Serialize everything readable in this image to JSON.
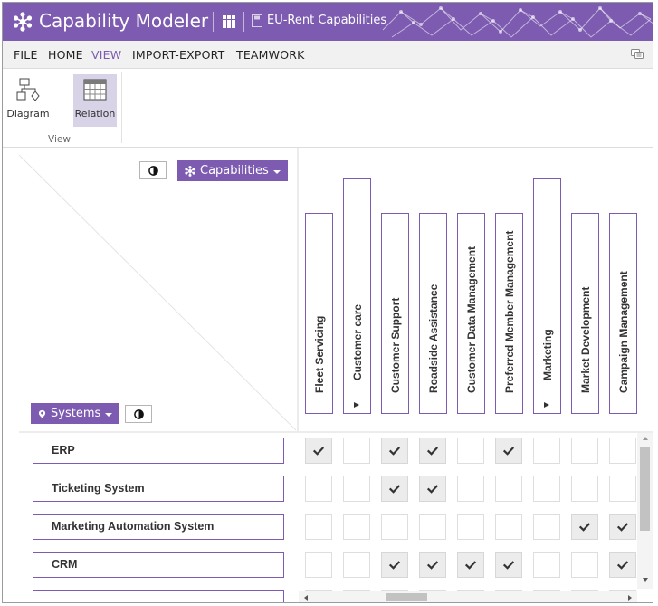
{
  "app": {
    "title": "Capability Modeler",
    "document": "EU-Rent Capabilities",
    "accent_color": "#7c5bb0"
  },
  "menu": {
    "items": [
      {
        "label": "FILE",
        "active": false
      },
      {
        "label": "HOME",
        "active": false
      },
      {
        "label": "VIEW",
        "active": true
      },
      {
        "label": "IMPORT-EXPORT",
        "active": false
      },
      {
        "label": "TEAMWORK",
        "active": false
      }
    ],
    "chat_icon": "chat-icon"
  },
  "ribbon": {
    "buttons": [
      {
        "label": "Diagram",
        "icon": "diagram-icon",
        "active": false
      },
      {
        "label": "Relation",
        "icon": "relation-grid-icon",
        "active": true
      }
    ],
    "group_label": "View"
  },
  "matrix": {
    "capabilities_button": "Capabilities",
    "systems_button": "Systems",
    "columns": [
      {
        "label": "Fleet Servicing",
        "expandable": false
      },
      {
        "label": "Customer care",
        "expandable": true
      },
      {
        "label": "Customer Support",
        "expandable": false
      },
      {
        "label": "Roadside Assistance",
        "expandable": false
      },
      {
        "label": "Customer Data Management",
        "expandable": false
      },
      {
        "label": "Preferred Member Management",
        "expandable": false
      },
      {
        "label": "Marketing",
        "expandable": true
      },
      {
        "label": "Market Development",
        "expandable": false
      },
      {
        "label": "Campaign Management",
        "expandable": false
      }
    ],
    "rows": [
      {
        "label": "ERP",
        "checks": [
          true,
          false,
          true,
          true,
          false,
          true,
          false,
          false,
          false
        ]
      },
      {
        "label": "Ticketing System",
        "checks": [
          false,
          false,
          true,
          true,
          false,
          false,
          false,
          false,
          false
        ]
      },
      {
        "label": "Marketing Automation System",
        "checks": [
          false,
          false,
          false,
          false,
          false,
          false,
          false,
          true,
          true
        ]
      },
      {
        "label": "CRM",
        "checks": [
          false,
          false,
          true,
          true,
          true,
          true,
          false,
          false,
          true
        ]
      },
      {
        "label": "",
        "checks": [
          false,
          false,
          false,
          false,
          false,
          false,
          false,
          false,
          false
        ]
      }
    ]
  }
}
